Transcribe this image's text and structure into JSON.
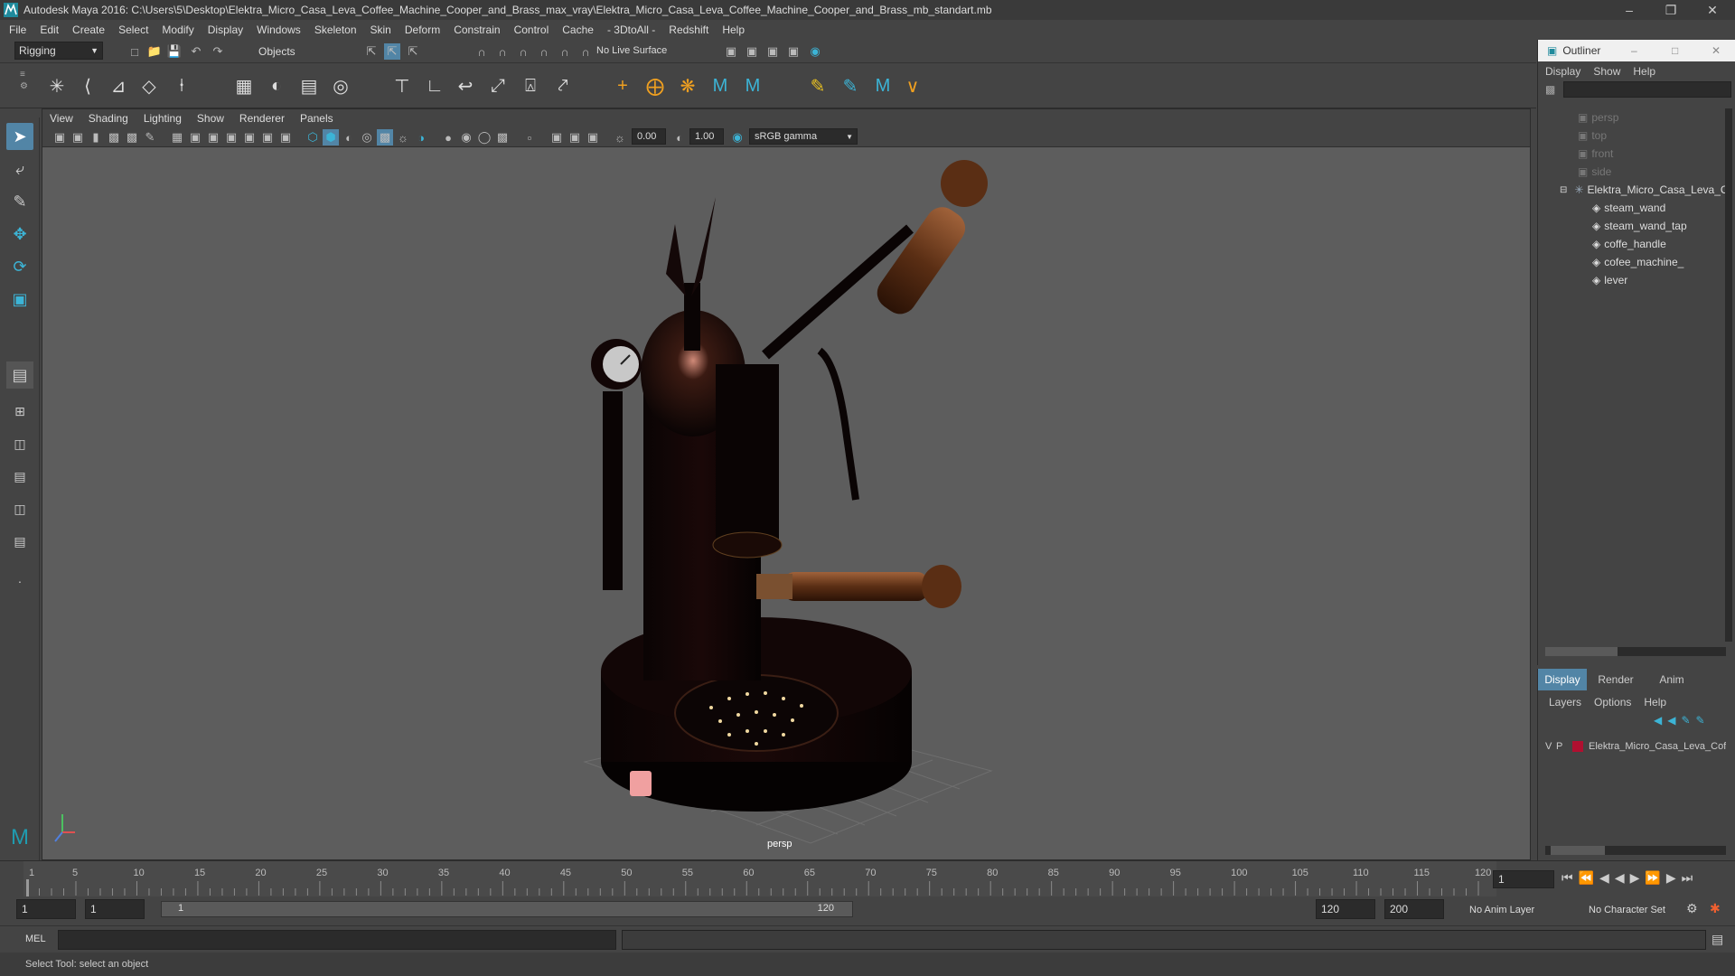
{
  "window": {
    "title": "Autodesk Maya 2016: C:\\Users\\5\\Desktop\\Elektra_Micro_Casa_Leva_Coffee_Machine_Cooper_and_Brass_max_vray\\Elektra_Micro_Casa_Leva_Coffee_Machine_Cooper_and_Brass_mb_standart.mb"
  },
  "menubar": [
    "File",
    "Edit",
    "Create",
    "Select",
    "Modify",
    "Display",
    "Windows",
    "Skeleton",
    "Skin",
    "Deform",
    "Constrain",
    "Control",
    "Cache",
    "- 3DtoAll -",
    "Redshift",
    "Help"
  ],
  "shelf": {
    "mode": "Rigging",
    "objects_label": "Objects",
    "live_surface": "No Live Surface"
  },
  "viewport": {
    "menus": [
      "View",
      "Shading",
      "Lighting",
      "Show",
      "Renderer",
      "Panels"
    ],
    "exposure": "0.00",
    "gamma": "1.00",
    "colorspace": "sRGB gamma",
    "camera_label": "persp"
  },
  "outliner": {
    "title": "Outliner",
    "menus": [
      "Display",
      "Show",
      "Help"
    ],
    "cameras": [
      "persp",
      "top",
      "front",
      "side"
    ],
    "group": "Elektra_Micro_Casa_Leva_C",
    "children": [
      "steam_wand",
      "steam_wand_tap",
      "coffe_handle",
      "cofee_machine_",
      "lever"
    ]
  },
  "layers": {
    "tabs": [
      "Display",
      "Render",
      "Anim"
    ],
    "menus": [
      "Layers",
      "Options",
      "Help"
    ],
    "layer_name": "Elektra_Micro_Casa_Leva_Cof",
    "v_flag": "V",
    "p_flag": "P",
    "layer_color": "#b01030"
  },
  "timeline": {
    "ticks": [
      "1",
      "5",
      "10",
      "15",
      "20",
      "25",
      "30",
      "35",
      "40",
      "45",
      "50",
      "55",
      "60",
      "65",
      "70",
      "75",
      "80",
      "85",
      "90",
      "95",
      "100",
      "105",
      "110",
      "115",
      "120"
    ],
    "current_frame": "1"
  },
  "range": {
    "start": "1",
    "anim_start": "1",
    "slider_start": "1",
    "slider_end": "120",
    "anim_end": "120",
    "end": "200",
    "anim_layer": "No Anim Layer",
    "char_set": "No Character Set"
  },
  "mel": {
    "label": "MEL"
  },
  "help": {
    "text": "Select Tool: select an object"
  },
  "colors": {
    "accent": "#5285a6",
    "bg": "#444444",
    "viewport": "#5d5d5d"
  }
}
